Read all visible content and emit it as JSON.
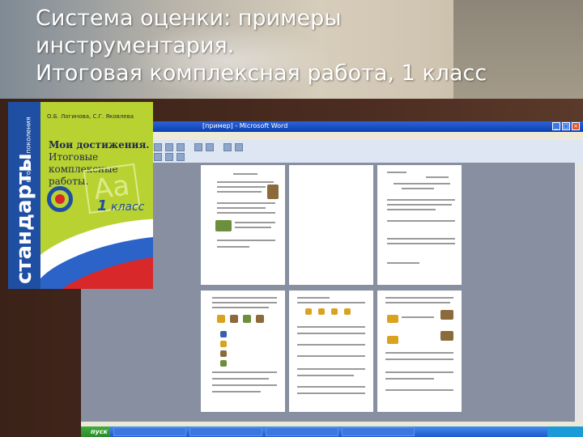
{
  "slide": {
    "title_lines": [
      "Система оценки: примеры",
      "инструментария.",
      "Итоговая комплексная работа, 1 класс"
    ]
  },
  "book": {
    "authors": "О.Б. Логинова, С.Г. Яковлева",
    "title_line1": "Мои достижения.",
    "title_line2": "Итоговые",
    "title_line3": "комплексные работы.",
    "grade_number": "1",
    "grade_word": "класс",
    "series_main": "стандарты",
    "series_sub": "второго поколения"
  },
  "word_window": {
    "title": "[пример] - Microsoft Word"
  },
  "taskbar": {
    "start_label": "пуск"
  },
  "colors": {
    "book_green": "#b8d232",
    "book_blue": "#1f4fa3",
    "book_red": "#d8282a",
    "xp_blue": "#2258c9"
  }
}
